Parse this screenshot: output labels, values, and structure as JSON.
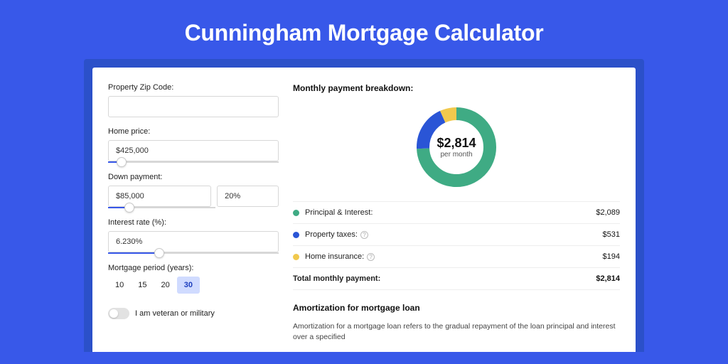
{
  "hero": {
    "title": "Cunningham Mortgage Calculator"
  },
  "form": {
    "zip": {
      "label": "Property Zip Code:",
      "value": ""
    },
    "homePrice": {
      "label": "Home price:",
      "value": "$425,000",
      "sliderPct": 8
    },
    "downPayment": {
      "label": "Down payment:",
      "amount": "$85,000",
      "pct": "20%",
      "sliderPct": 20
    },
    "interest": {
      "label": "Interest rate (%):",
      "value": "6.230%",
      "sliderPct": 30
    },
    "period": {
      "label": "Mortgage period (years):",
      "options": [
        "10",
        "15",
        "20",
        "30"
      ],
      "active": "30"
    },
    "veteran": {
      "label": "I am veteran or military",
      "on": false
    }
  },
  "breakdown": {
    "title": "Monthly payment breakdown:",
    "centerAmount": "$2,814",
    "centerSub": "per month",
    "items": [
      {
        "label": "Principal & Interest:",
        "value": "$2,089",
        "color": "#3fab84",
        "info": false
      },
      {
        "label": "Property taxes:",
        "value": "$531",
        "color": "#2a55d6",
        "info": true
      },
      {
        "label": "Home insurance:",
        "value": "$194",
        "color": "#f1c94d",
        "info": true
      }
    ],
    "total": {
      "label": "Total monthly payment:",
      "value": "$2,814"
    }
  },
  "chart_data": {
    "type": "pie",
    "title": "Monthly payment breakdown",
    "series": [
      {
        "name": "Principal & Interest",
        "value": 2089,
        "color": "#3fab84"
      },
      {
        "name": "Property taxes",
        "value": 531,
        "color": "#2a55d6"
      },
      {
        "name": "Home insurance",
        "value": 194,
        "color": "#f1c94d"
      }
    ],
    "total": 2814,
    "center_label": "$2,814 per month"
  },
  "amort": {
    "title": "Amortization for mortgage loan",
    "body": "Amortization for a mortgage loan refers to the gradual repayment of the loan principal and interest over a specified"
  }
}
